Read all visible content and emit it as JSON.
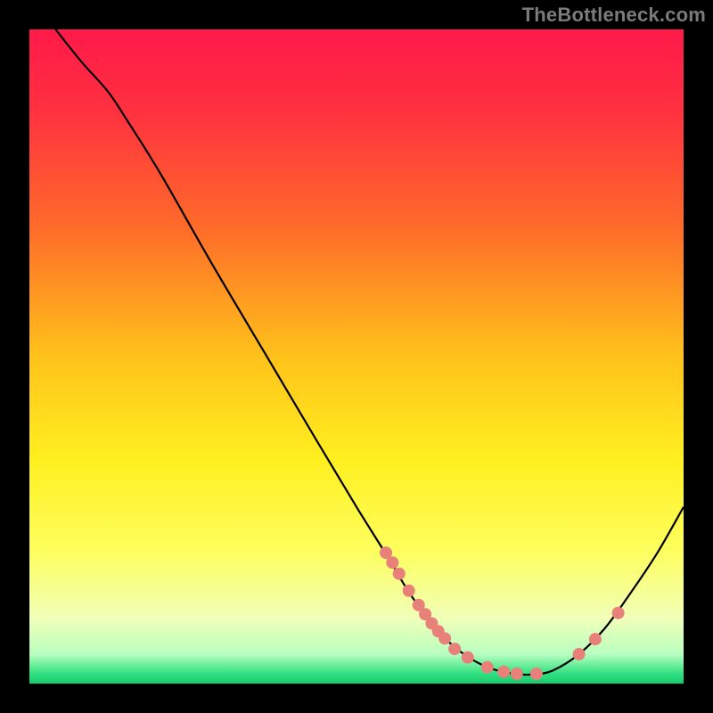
{
  "attribution": "TheBottleneck.com",
  "chart_data": {
    "type": "line",
    "title": "",
    "xlabel": "",
    "ylabel": "",
    "xlim": [
      0,
      100
    ],
    "ylim": [
      0,
      100
    ],
    "gradient_stops": [
      {
        "offset": 0.0,
        "color": "#ff1a49"
      },
      {
        "offset": 0.12,
        "color": "#ff3040"
      },
      {
        "offset": 0.3,
        "color": "#ff6a2a"
      },
      {
        "offset": 0.5,
        "color": "#ffc21a"
      },
      {
        "offset": 0.66,
        "color": "#fff020"
      },
      {
        "offset": 0.8,
        "color": "#fdff60"
      },
      {
        "offset": 0.9,
        "color": "#f1ffb8"
      },
      {
        "offset": 0.955,
        "color": "#b8ffc0"
      },
      {
        "offset": 0.985,
        "color": "#30e080"
      },
      {
        "offset": 1.0,
        "color": "#16cc6e"
      }
    ],
    "curve": [
      {
        "x": 4.0,
        "y": 100.0
      },
      {
        "x": 8.0,
        "y": 95.0
      },
      {
        "x": 12.0,
        "y": 90.5
      },
      {
        "x": 15.0,
        "y": 86.0
      },
      {
        "x": 20.0,
        "y": 78.0
      },
      {
        "x": 28.0,
        "y": 64.0
      },
      {
        "x": 36.0,
        "y": 50.5
      },
      {
        "x": 44.0,
        "y": 37.0
      },
      {
        "x": 50.0,
        "y": 27.0
      },
      {
        "x": 55.0,
        "y": 19.0
      },
      {
        "x": 58.0,
        "y": 14.0
      },
      {
        "x": 62.0,
        "y": 8.5
      },
      {
        "x": 66.0,
        "y": 4.8
      },
      {
        "x": 70.0,
        "y": 2.5
      },
      {
        "x": 74.0,
        "y": 1.5
      },
      {
        "x": 77.0,
        "y": 1.4
      },
      {
        "x": 80.0,
        "y": 2.0
      },
      {
        "x": 84.0,
        "y": 4.5
      },
      {
        "x": 88.0,
        "y": 8.5
      },
      {
        "x": 92.0,
        "y": 14.0
      },
      {
        "x": 96.0,
        "y": 20.0
      },
      {
        "x": 100.0,
        "y": 27.0
      }
    ],
    "marker_points": [
      {
        "x": 54.5,
        "y": 20.0
      },
      {
        "x": 55.5,
        "y": 18.5
      },
      {
        "x": 56.5,
        "y": 16.8
      },
      {
        "x": 58.0,
        "y": 14.2
      },
      {
        "x": 59.5,
        "y": 12.0
      },
      {
        "x": 60.5,
        "y": 10.6
      },
      {
        "x": 61.5,
        "y": 9.2
      },
      {
        "x": 62.5,
        "y": 8.0
      },
      {
        "x": 63.5,
        "y": 6.9
      },
      {
        "x": 65.0,
        "y": 5.3
      },
      {
        "x": 67.0,
        "y": 4.0
      },
      {
        "x": 70.0,
        "y": 2.5
      },
      {
        "x": 72.5,
        "y": 1.8
      },
      {
        "x": 74.5,
        "y": 1.5
      },
      {
        "x": 77.5,
        "y": 1.5
      },
      {
        "x": 84.0,
        "y": 4.5
      },
      {
        "x": 86.5,
        "y": 6.8
      },
      {
        "x": 90.0,
        "y": 10.8
      }
    ],
    "marker_color": "#e88179",
    "curve_color": "#000000"
  }
}
